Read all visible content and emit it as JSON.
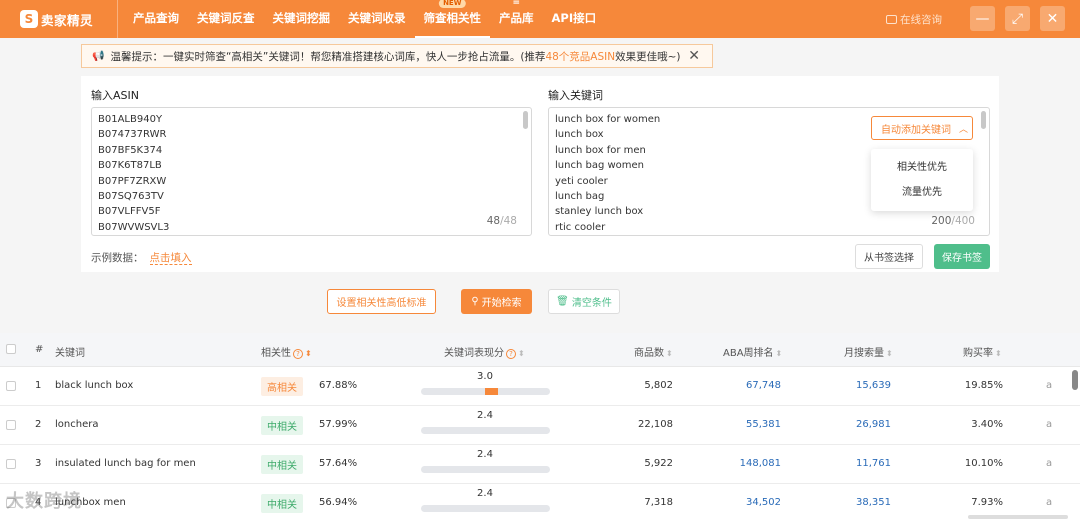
{
  "app": {
    "logo_text": "卖家精灵",
    "logo_mark": "S"
  },
  "nav": [
    {
      "label": "产品查询",
      "badge": ""
    },
    {
      "label": "关键词反查",
      "badge": ""
    },
    {
      "label": "关键词挖掘",
      "badge": ""
    },
    {
      "label": "关键词收录",
      "badge": ""
    },
    {
      "label": "筛查相关性",
      "badge": "NEW"
    },
    {
      "label": "产品库",
      "badge": ""
    },
    {
      "label": "API接口",
      "badge": ""
    }
  ],
  "header": {
    "online_label": "在线咨询",
    "minimize": "—",
    "maximize": "⤢",
    "close": "✕"
  },
  "tip": {
    "icon": "📢",
    "text_prefix": "温馨提示：一键实时筛查“高相关”关键词！帮您精准搭建核心词库，快人一步抢占流量。(推荐",
    "link_text": "48个竞品ASIN",
    "text_suffix": "效果更佳哦~)",
    "close": "✕"
  },
  "asin_input": {
    "label": "输入ASIN",
    "lines": [
      "B01ALB940Y",
      "B074737RWR",
      "B07BF5K374",
      "B07K6T87LB",
      "B07PF7ZRXW",
      "B07SQ763TV",
      "B07VLFFV5F",
      "B07WVWSVL3"
    ],
    "count": "48",
    "max": "/48"
  },
  "keyword_input": {
    "label": "输入关键词",
    "lines": [
      "lunch box for women",
      "lunch box",
      "lunch box for men",
      "lunch bag women",
      "yeti cooler",
      "lunch bag",
      "stanley lunch box",
      "rtic cooler"
    ],
    "count": "200",
    "max": "/400",
    "auto_add_label": "自动添加关键词",
    "dropdown_options": [
      "相关性优先",
      "流量优先"
    ]
  },
  "example": {
    "label": "示例数据：",
    "link": "点击填入"
  },
  "buttons": {
    "bookmark_select": "从书签选择",
    "save_bookmark": "保存书签",
    "set_standard": "设置相关性高低标准",
    "start_search": "开始检索",
    "clear": "清空条件"
  },
  "table": {
    "headers": {
      "index": "#",
      "keyword": "关键词",
      "relevance": "相关性",
      "score": "关键词表现分",
      "products": "商品数",
      "aba_rank": "ABA周排名",
      "monthly_search": "月搜索量",
      "purchase_rate": "购买率"
    },
    "rows": [
      {
        "index": "1",
        "keyword": "black lunch box",
        "relevance": "高相关",
        "relevance_level": "high",
        "relevance_pct": "67.88%",
        "score": "3.0",
        "score_fill": 0.6,
        "products": "5,802",
        "aba_rank": "67,748",
        "monthly_search": "15,639",
        "purchase_rate": "19.85%",
        "marketplace_icon": "a"
      },
      {
        "index": "2",
        "keyword": "lonchera",
        "relevance": "中相关",
        "relevance_level": "mid",
        "relevance_pct": "57.99%",
        "score": "2.4",
        "score_fill": 0.48,
        "products": "22,108",
        "aba_rank": "55,381",
        "monthly_search": "26,981",
        "purchase_rate": "3.40%",
        "marketplace_icon": "a"
      },
      {
        "index": "3",
        "keyword": "insulated lunch bag for men",
        "relevance": "中相关",
        "relevance_level": "mid",
        "relevance_pct": "57.64%",
        "score": "2.4",
        "score_fill": 0.48,
        "products": "5,922",
        "aba_rank": "148,081",
        "monthly_search": "11,761",
        "purchase_rate": "10.10%",
        "marketplace_icon": "a"
      },
      {
        "index": "4",
        "keyword": "lunchbox men",
        "relevance": "中相关",
        "relevance_level": "mid",
        "relevance_pct": "56.94%",
        "score": "2.4",
        "score_fill": 0.48,
        "products": "7,318",
        "aba_rank": "34,502",
        "monthly_search": "38,351",
        "purchase_rate": "7.93%",
        "marketplace_icon": "a"
      }
    ]
  },
  "watermark": "大数跨境",
  "colors": {
    "brand": "#f6883a",
    "green": "#4fbe8b",
    "link_blue": "#2a6bb8"
  }
}
